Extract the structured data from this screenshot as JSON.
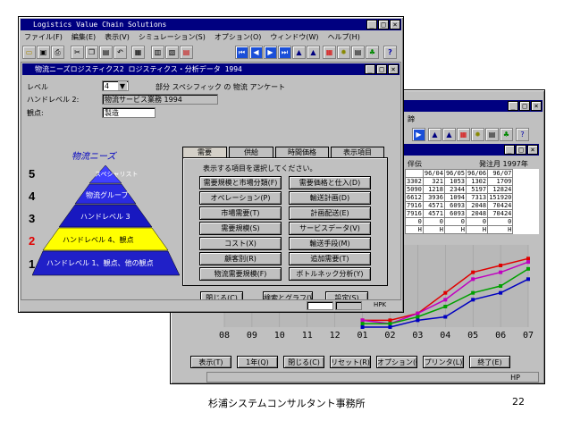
{
  "back_window": {
    "partial_menu": "蹄",
    "col_header_left": "伴伝",
    "col_header_right": "発注月 1997年",
    "table_headers": [
      "96/04",
      "96/05",
      "96/06",
      "96/07"
    ],
    "table_rows": [
      [
        "3302",
        "321",
        "1053",
        "1302",
        "1709"
      ],
      [
        "5090",
        "1218",
        "2344",
        "5197",
        "12824"
      ],
      [
        "6612",
        "3936",
        "1094",
        "7313",
        "151920"
      ],
      [
        "7916",
        "4571",
        "6093",
        "2048",
        "70424"
      ],
      [
        "7916",
        "4571",
        "6093",
        "2048",
        "70424"
      ],
      [
        "0",
        "0",
        "0",
        "0",
        "0"
      ],
      [
        "H",
        "H",
        "H",
        "H",
        "H"
      ]
    ],
    "x_ticks": [
      "08",
      "09",
      "10",
      "11",
      "12",
      "01",
      "02",
      "03",
      "04",
      "05",
      "06",
      "07"
    ],
    "buttons": [
      "表示(T)",
      "1年(Q)",
      "閉じる(C)",
      "リセット(R)",
      "オプション(O)",
      "プリンタ(L)",
      "終了(E)"
    ],
    "status": "HP"
  },
  "front_window": {
    "app_title": "Logistics Value Chain Solutions",
    "menu": [
      "ファイル(F)",
      "編集(E)",
      "表示(V)",
      "シミュレーション(S)",
      "オプション(O)",
      "ウィンドウ(W)",
      "ヘルプ(H)"
    ],
    "child_title": "物流ニーズロジスティクス2 ロジスティクス・分析データ 1994",
    "level_label": "レベル",
    "level_value": "4",
    "level_desc": "部分 スペシフィック の 物流 アンケート",
    "level2_label": "ハンドレベル 2:",
    "level2_value": "物流サービス業務 1994",
    "viewpoint_label": "観点:",
    "viewpoint_value": "製造",
    "pyramid_title": "物流ニーズ",
    "pyramid_levels": [
      {
        "num": "5",
        "text": "スペシャリスト"
      },
      {
        "num": "4",
        "text": "物流グループ"
      },
      {
        "num": "3",
        "text": "ハンドレベル 3"
      },
      {
        "num": "2",
        "text": "ハンドレベル 4、観点"
      },
      {
        "num": "1",
        "text": "ハンドレベル 1、観点、他の観点"
      }
    ],
    "tabs": [
      "需要",
      "供給",
      "時間価格",
      "表示項目"
    ],
    "tab_instruction": "表示する項目を選択してください。",
    "options": [
      [
        "需要規模と市場分類(F)",
        "需要価格と仕入(D)"
      ],
      [
        "オペレーション(P)",
        "輸送計画(D)"
      ],
      [
        "市場需要(T)",
        "計画配送(E)"
      ],
      [
        "需要規模(S)",
        "サービスデータ(V)"
      ],
      [
        "コスト(X)",
        "輸送手段(M)"
      ],
      [
        "顧客別(R)",
        "追加需要(T)"
      ],
      [
        "物流需要規模(F)",
        "ボトルネック分析(Y)"
      ]
    ],
    "bottom_buttons": [
      "閉じる(C)",
      "検索とグラフ(W)",
      "設定(S)"
    ],
    "status_right": "HPK"
  },
  "footer": {
    "caption": "杉浦システムコンサルタント事務所",
    "page": "22"
  },
  "colors": {
    "title_bar": "#000080",
    "pyramid": [
      "#4040ff",
      "#2a2ae0",
      "#1818c0",
      "#ffff00",
      "#2020c8"
    ],
    "series": [
      "#e00000",
      "#c000c0",
      "#00a000",
      "#0000c0"
    ]
  },
  "chart_data": {
    "type": "line",
    "x": [
      "08",
      "09",
      "10",
      "11",
      "12",
      "01",
      "02",
      "03",
      "04",
      "05",
      "06",
      "07"
    ],
    "series": [
      {
        "values": [
          null,
          null,
          null,
          null,
          null,
          1,
          1,
          2,
          5,
          8,
          9,
          10
        ]
      },
      {
        "values": [
          null,
          null,
          null,
          null,
          null,
          1,
          0.5,
          2,
          4,
          7,
          8,
          9.5
        ]
      },
      {
        "values": [
          null,
          null,
          null,
          null,
          null,
          0.5,
          0.5,
          1.5,
          3,
          5,
          6,
          8.5
        ]
      },
      {
        "values": [
          null,
          null,
          null,
          null,
          null,
          0,
          0,
          1,
          1.5,
          4,
          5,
          7
        ]
      }
    ],
    "ylim": [
      0,
      12
    ]
  }
}
